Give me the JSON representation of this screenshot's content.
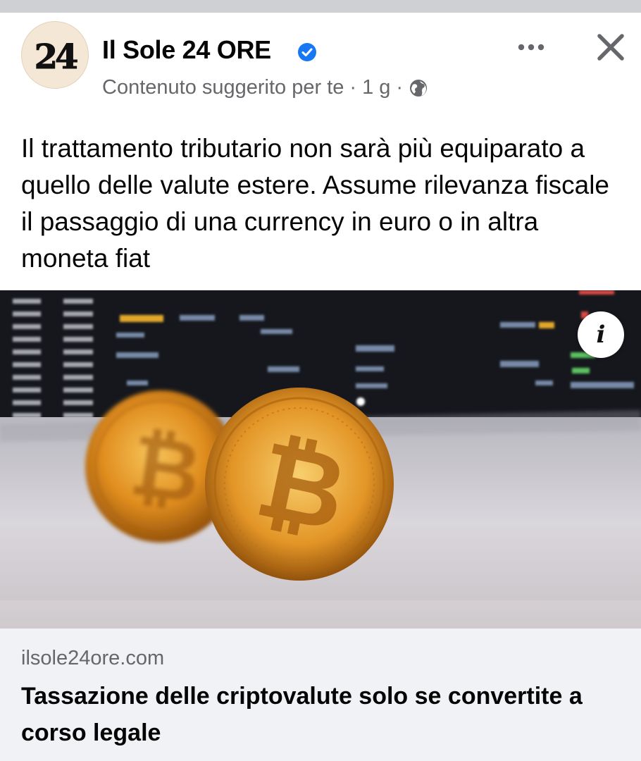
{
  "page": {
    "name": "Il Sole 24 ORE",
    "logo_text": "24",
    "meta": {
      "label": "Contenuto suggerito per te",
      "separator": "·",
      "time": "1 g"
    }
  },
  "post": {
    "text": "Il trattamento tributario non sarà più equiparato a quello delle valute estere. Assume rilevanza fiscale il passaggio di una currency in euro o in altra moneta fiat"
  },
  "media": {
    "info_label": "i"
  },
  "link": {
    "domain": "ilsole24ore.com",
    "title": "Tassazione delle criptovalute solo se convertite a corso legale"
  },
  "icons": {
    "verified": "verified-badge-icon",
    "globe": "globe-icon",
    "more": "more-options-icon",
    "close": "close-icon",
    "info": "info-icon"
  },
  "colors": {
    "verified_blue": "#1877f2",
    "secondary_text": "#65676b",
    "link_background": "#f0f2f5"
  }
}
